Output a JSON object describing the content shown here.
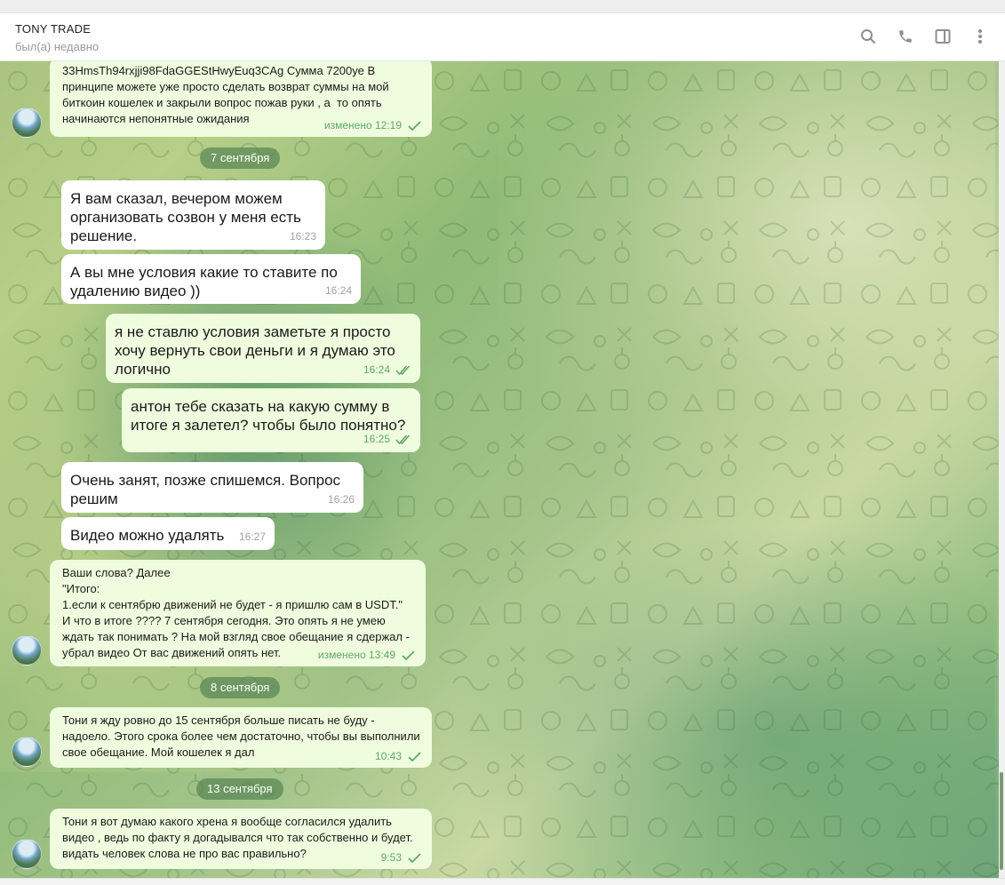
{
  "header": {
    "title": "TONY TRADE",
    "status": "был(а) недавно"
  },
  "dates": [
    "7 сентября",
    "8 сентября",
    "13 сентября"
  ],
  "messages": [
    {
      "dir": "out",
      "text": "33HmsTh94rxjji98FdaGGEStHwyEuq3CAg Сумма 7200уе В принципе можете уже просто сделать возврат суммы на мой биткоин кошелек и закрыли вопрос пожав руки , а  то опять начинаются непонятные ожидания",
      "time": "изменено 12:19",
      "ticks": "single"
    },
    {
      "dir": "in",
      "text": "Я вам сказал, вечером можем организовать созвон у меня есть решение.",
      "time": "16:23"
    },
    {
      "dir": "in",
      "text": "А вы мне условия какие то ставите по удалению видео ))",
      "time": "16:24"
    },
    {
      "dir": "out",
      "text": "я не ставлю условия заметьте я просто хочу вернуть свои деньги и я думаю это логично",
      "time": "16:24",
      "ticks": "double"
    },
    {
      "dir": "out",
      "text": "антон тебе сказать на какую сумму в итоге я залетел? чтобы было понятно?",
      "time": "16:25",
      "ticks": "double"
    },
    {
      "dir": "in",
      "text": "Очень занят, позже спишемся. Вопрос решим",
      "time": "16:26"
    },
    {
      "dir": "in",
      "text": "Видео можно удалять",
      "time": "16:27"
    },
    {
      "dir": "out",
      "text": "Ваши слова? Далее\n\"Итого:\n1.если к сентябрю движений не будет - я пришлю сам в USDT.\"\nИ что в итоге ???? 7 сентября сегодня. Это опять я не умею ждать так понимать ? На мой взгляд свое обещание я сдержал -  убрал видео От вас движений опять нет.",
      "time": "изменено 13:49",
      "ticks": "single"
    },
    {
      "dir": "out",
      "text": "Тони я жду ровно до 15 сентября больше писать не буду - надоело. Этого срока более чем достаточно, чтобы вы выполнили свое обещание. Мой кошелек я дал",
      "time": "10:43",
      "ticks": "single"
    },
    {
      "dir": "out",
      "text": "Тони я вот думаю какого хрена я вообще согласился удалить видео , ведь по факту я догадывался что так собственно и будет. видать человек слова не про вас правильно?",
      "time": "9:53",
      "ticks": "single"
    }
  ],
  "icons": [
    "search-icon",
    "phone-icon",
    "sidebar-toggle-icon",
    "more-vertical-icon"
  ],
  "colors": {
    "incoming_bubble": "#ffffff",
    "outgoing_bubble": "#effdde",
    "outgoing_meta": "#5fa86a",
    "date_pill": "#568452"
  }
}
